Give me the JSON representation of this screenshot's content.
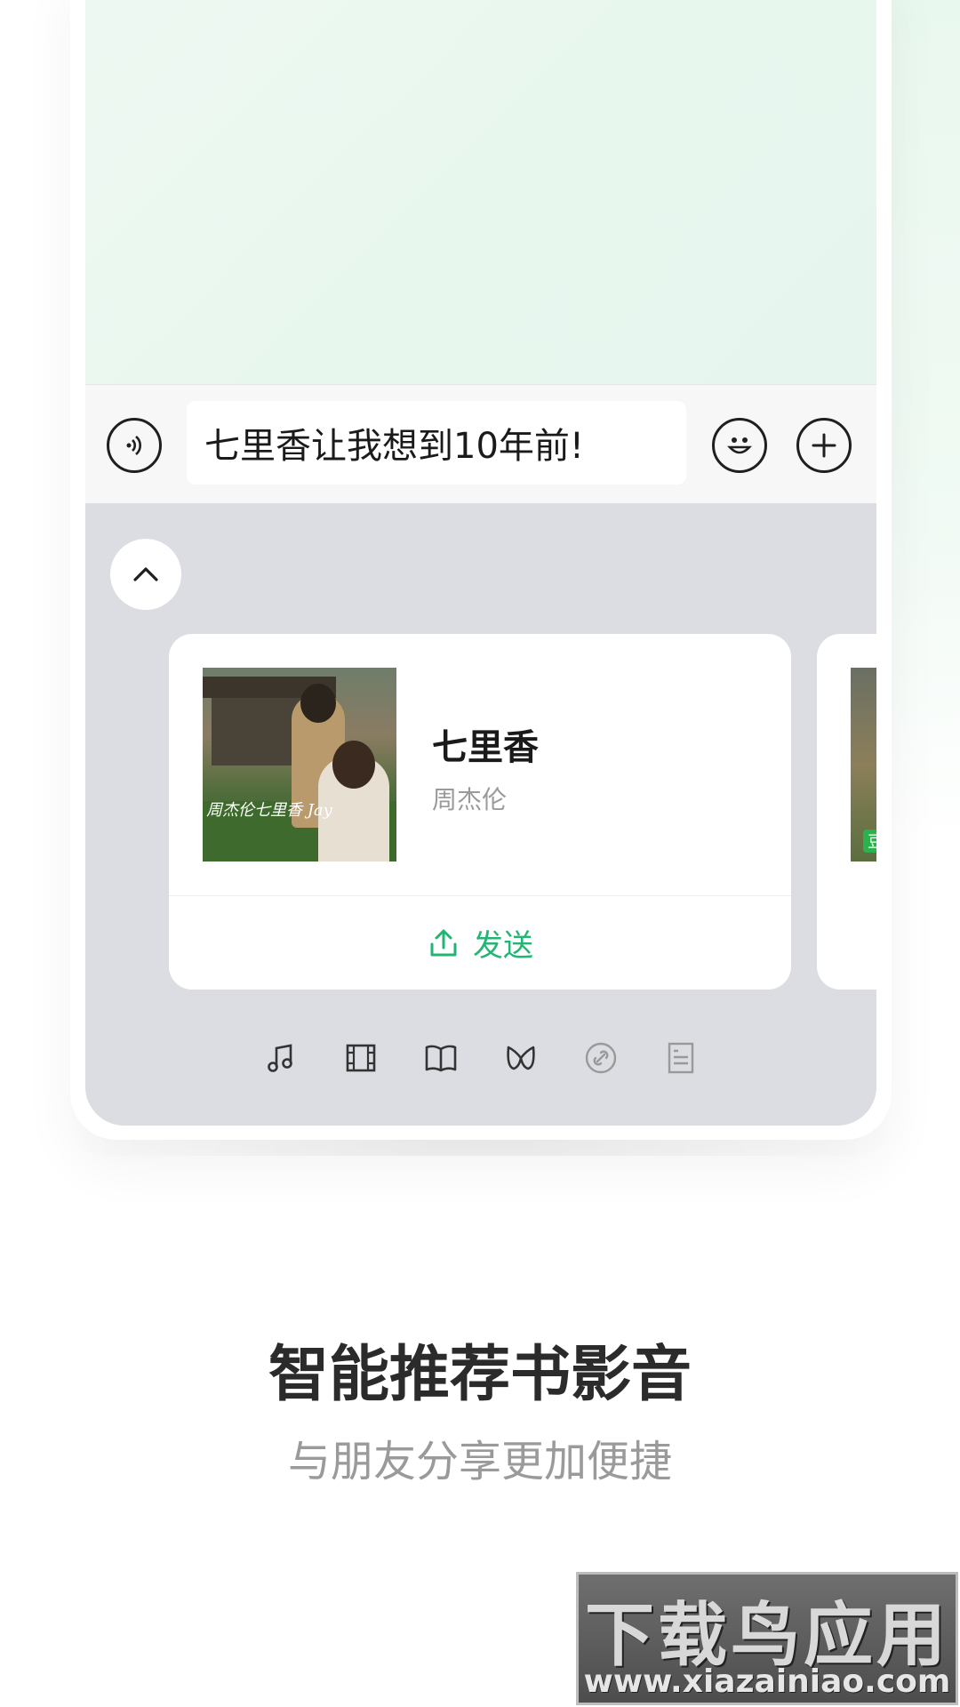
{
  "input_bar": {
    "message": "七里香让我想到10年前!"
  },
  "card": {
    "title": "七里香",
    "artist": "周杰伦",
    "cover_text": "周杰伦七里香 Jay",
    "send_label": "发送"
  },
  "peek_card": {
    "badge": "豆"
  },
  "tabs": [
    {
      "icon": "music-note-icon"
    },
    {
      "icon": "film-icon"
    },
    {
      "icon": "book-icon"
    },
    {
      "icon": "bow-tie-icon"
    },
    {
      "icon": "link-icon"
    },
    {
      "icon": "document-icon"
    }
  ],
  "promo": {
    "headline": "智能推荐书影音",
    "subline": "与朋友分享更加便捷"
  },
  "watermark": {
    "title": "下载鸟应用",
    "url": "www.xiazainiao.com"
  },
  "colors": {
    "accent_green": "#22b573",
    "panel_gray": "#dcdde2",
    "chat_bg": "#e8f7ee"
  }
}
